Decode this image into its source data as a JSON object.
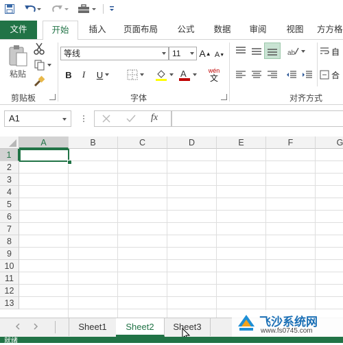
{
  "colors": {
    "accent": "#217346",
    "file_tab": "#217346",
    "status": "#217346"
  },
  "quick_access": {
    "icons": [
      "save-icon",
      "undo-icon",
      "redo-icon",
      "briefcase-icon",
      "customize-icon"
    ]
  },
  "tabs": [
    {
      "label": "文件"
    },
    {
      "label": "开始"
    },
    {
      "label": "插入"
    },
    {
      "label": "页面布局"
    },
    {
      "label": "公式"
    },
    {
      "label": "数据"
    },
    {
      "label": "审阅"
    },
    {
      "label": "视图"
    },
    {
      "label": "方方格"
    }
  ],
  "ribbon": {
    "clipboard": {
      "paste_label": "粘贴",
      "group_label": "剪贴板"
    },
    "font": {
      "font_name": "等线",
      "font_size": "11",
      "group_label": "字体",
      "bold": "B",
      "italic": "I",
      "underline": "U",
      "grow": "A",
      "shrink": "A",
      "wen": "wén",
      "wen_char": "文"
    },
    "alignment": {
      "group_label": "对齐方式",
      "wrap_label": "自",
      "merge_label": "合"
    }
  },
  "formula_bar": {
    "name_box": "A1",
    "fx": "fx",
    "formula": ""
  },
  "sheet": {
    "columns": [
      "A",
      "B",
      "C",
      "D",
      "E",
      "F",
      "G"
    ],
    "rows": [
      "1",
      "2",
      "3",
      "4",
      "5",
      "6",
      "7",
      "8",
      "9",
      "10",
      "11",
      "12",
      "13"
    ],
    "active_cell": "A1"
  },
  "sheet_tabs": [
    {
      "label": "Sheet1"
    },
    {
      "label": "Sheet2"
    },
    {
      "label": "Sheet3"
    }
  ],
  "status": {
    "text": "就绪"
  },
  "watermark": {
    "brand": "飞沙系统网",
    "url": "www.fs0745.com"
  }
}
